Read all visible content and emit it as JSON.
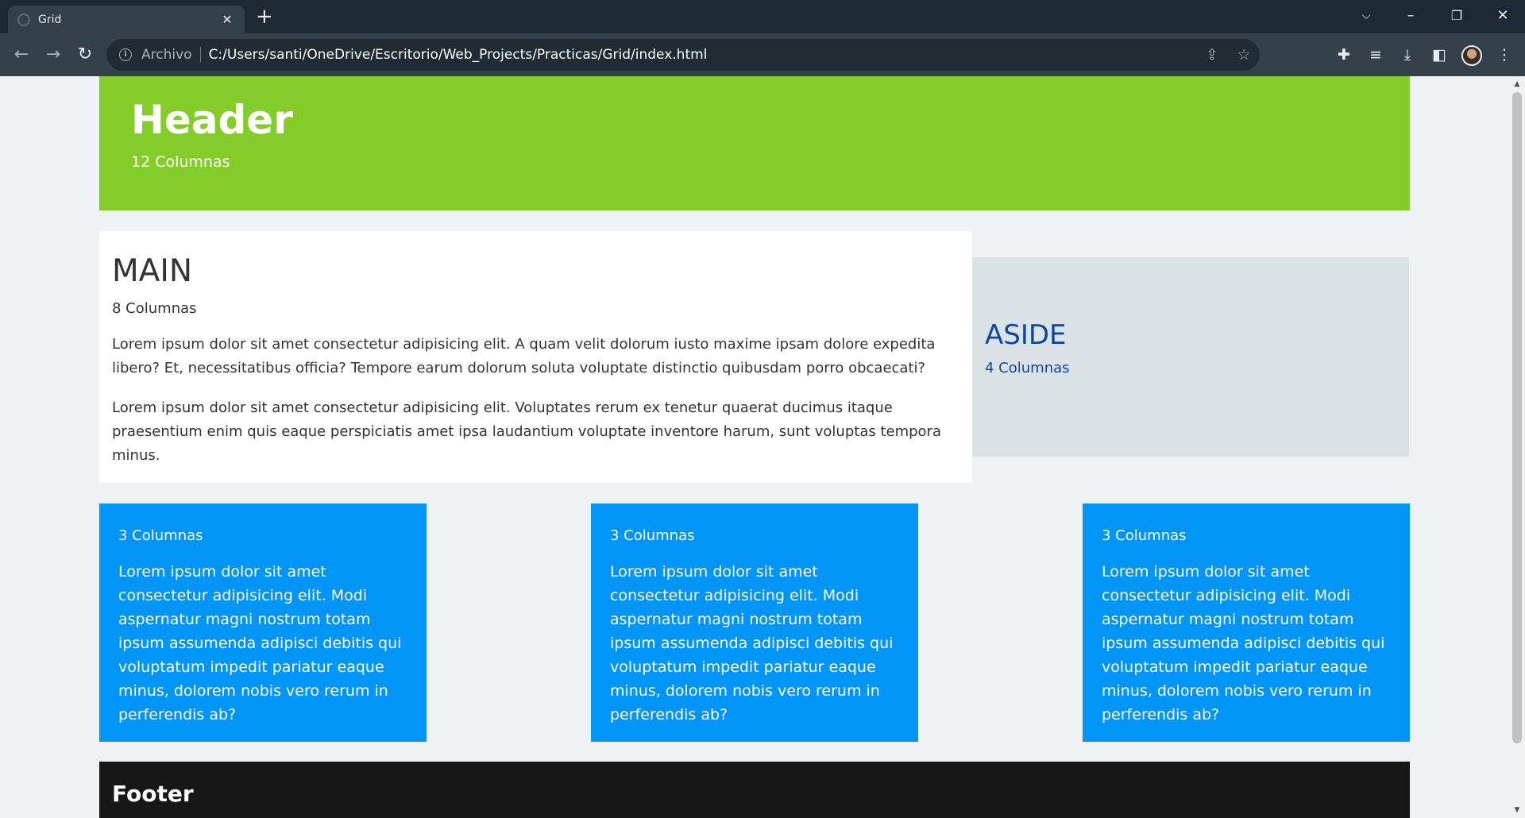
{
  "browser": {
    "tab_title": "Grid",
    "url_scheme": "Archivo",
    "url": "C:/Users/santi/OneDrive/Escritorio/Web_Projects/Practicas/Grid/index.html"
  },
  "page": {
    "header": {
      "title": "Header",
      "subtitle": "12 Columnas"
    },
    "main": {
      "title": "MAIN",
      "subtitle": "8 Columnas",
      "paragraphs": [
        "Lorem ipsum dolor sit amet consectetur adipisicing elit. A quam velit dolorum iusto maxime ipsam dolore expedita libero? Et, necessitatibus officia? Tempore earum dolorum soluta voluptate distinctio quibusdam porro obcaecati?",
        "Lorem ipsum dolor sit amet consectetur adipisicing elit. Voluptates rerum ex tenetur quaerat ducimus itaque praesentium enim quis eaque perspiciatis amet ipsa laudantium voluptate inventore harum, sunt voluptas tempora minus."
      ]
    },
    "aside": {
      "title": "ASIDE",
      "subtitle": "4 Columnas"
    },
    "cards": [
      {
        "subtitle": "3 Columnas",
        "text": "Lorem ipsum dolor sit amet consectetur adipisicing elit. Modi aspernatur magni nostrum totam ipsum assumenda adipisci debitis qui voluptatum impedit pariatur eaque minus, dolorem nobis vero rerum in perferendis ab?"
      },
      {
        "subtitle": "3 Columnas",
        "text": "Lorem ipsum dolor sit amet consectetur adipisicing elit. Modi aspernatur magni nostrum totam ipsum assumenda adipisci debitis qui voluptatum impedit pariatur eaque minus, dolorem nobis vero rerum in perferendis ab?"
      },
      {
        "subtitle": "3 Columnas",
        "text": "Lorem ipsum dolor sit amet consectetur adipisicing elit. Modi aspernatur magni nostrum totam ipsum assumenda adipisci debitis qui voluptatum impedit pariatur eaque minus, dolorem nobis vero rerum in perferendis ab?"
      }
    ],
    "footer": {
      "title": "Footer"
    }
  },
  "colors": {
    "header_bg": "#84cc29",
    "aside_bg": "#dbe2e6",
    "aside_text": "#0d47a1",
    "card_bg": "#0095f6",
    "footer_bg": "#171717",
    "page_bg": "#eef2f5"
  },
  "icons": {
    "tab_close": "close-icon",
    "new_tab": "plus-icon",
    "back": "arrow-left-icon",
    "forward": "arrow-right-icon",
    "reload": "reload-icon",
    "site_info": "info-icon",
    "share": "share-icon",
    "bookmark": "star-icon",
    "extensions": "puzzle-icon",
    "media": "media-queue-icon",
    "download": "download-icon",
    "side_panel": "side-panel-icon",
    "menu": "kebab-menu-icon"
  }
}
